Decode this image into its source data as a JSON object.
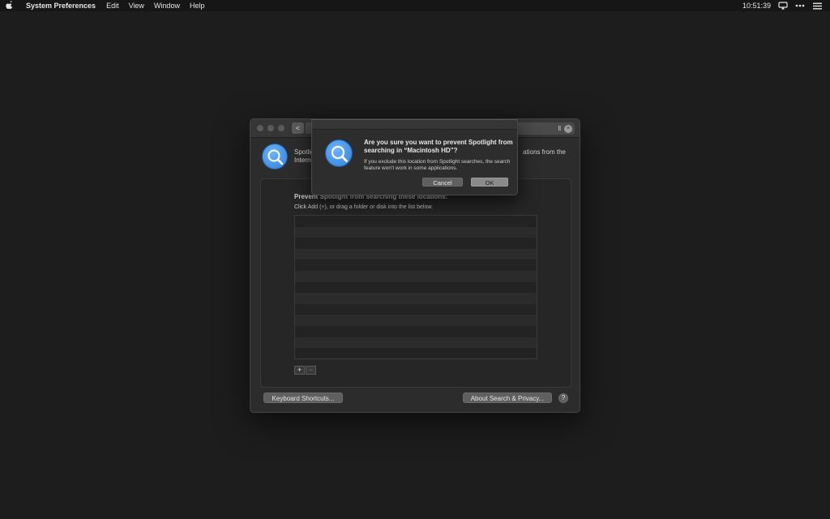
{
  "menubar": {
    "app_name": "System Preferences",
    "items": [
      "Edit",
      "View",
      "Window",
      "Help"
    ],
    "clock": "10:51:39",
    "icons": [
      "apple-icon",
      "airplay-icon",
      "control-strip-icon",
      "list-icon"
    ]
  },
  "window": {
    "traffic_lights": [
      "close",
      "minimize",
      "zoom"
    ],
    "back_glyph": "<",
    "search": {
      "value": "ll",
      "clear_glyph": "×"
    },
    "header": {
      "desc_line1": "Spotlight",
      "desc_line1_tail": "ations from the",
      "desc_line2": "Interne"
    },
    "privacy": {
      "title": "Prevent Spotlight from searching these locations:",
      "hint": "Click Add (+), or drag a folder or disk into the list below.",
      "add_label": "+",
      "remove_label": "−"
    },
    "buttons": {
      "keyboard_shortcuts": "Keyboard Shortcuts...",
      "about": "About Search & Privacy...",
      "help": "?"
    }
  },
  "alert": {
    "title": "Are you sure you want to prevent Spotlight from searching in “Macintosh HD”?",
    "message": "If you exclude this location from Spotlight searches, the search feature won’t work in some applications.",
    "cancel": "Cancel",
    "ok": "OK"
  },
  "colors": {
    "desktop": "#1d1d1d",
    "window": "#2c2c2c",
    "accent_icon": "#3a8ae6"
  }
}
